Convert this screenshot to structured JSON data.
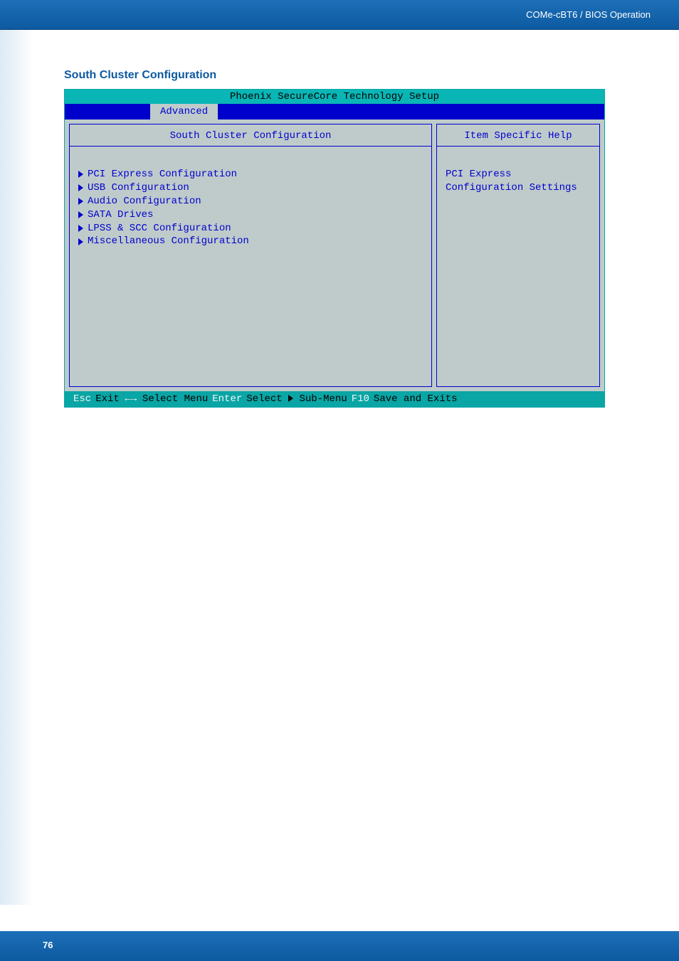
{
  "header": {
    "breadcrumb": "COMe-cBT6 / BIOS Operation"
  },
  "section": {
    "title": "South Cluster Configuration"
  },
  "bios": {
    "setup_title": "Phoenix SecureCore Technology Setup",
    "menu": {
      "advanced": "Advanced"
    },
    "left_panel": {
      "title": "South Cluster Configuration",
      "items": [
        "PCI Express Configuration",
        "USB Configuration",
        "Audio Configuration",
        "SATA Drives",
        "LPSS & SCC Configuration",
        "Miscellaneous Configuration"
      ]
    },
    "right_panel": {
      "title": "Item Specific Help",
      "help_line1": "PCI Express",
      "help_line2": "Configuration Settings"
    },
    "footer": {
      "esc_key": "Esc",
      "esc_label": "Exit",
      "select_menu": "Select Menu",
      "enter_key": "Enter",
      "select_sub": "Select   Sub-Menu",
      "f10_key": "F10",
      "save_label": "Save and Exits"
    }
  },
  "page_number": "76"
}
